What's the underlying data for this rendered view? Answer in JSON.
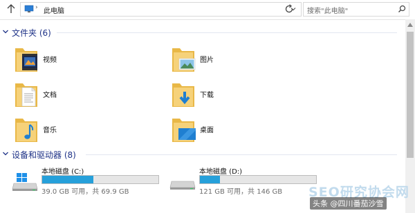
{
  "address_bar": {
    "path": "此电脑",
    "search_placeholder": "搜索\"此电脑\""
  },
  "groups": {
    "folders": {
      "title": "文件夹 (6)"
    },
    "devices": {
      "title": "设备和驱动器 (8)"
    }
  },
  "folders": [
    {
      "label": "视频",
      "icon": "videos-folder-icon"
    },
    {
      "label": "图片",
      "icon": "pictures-folder-icon"
    },
    {
      "label": "文档",
      "icon": "documents-folder-icon"
    },
    {
      "label": "下载",
      "icon": "downloads-folder-icon"
    },
    {
      "label": "音乐",
      "icon": "music-folder-icon"
    },
    {
      "label": "桌面",
      "icon": "desktop-folder-icon"
    }
  ],
  "drives": [
    {
      "name": "本地磁盘 (C:)",
      "size": "39.0 GB 可用，共 69.9 GB",
      "used_fraction": 0.44,
      "icon": "windows-drive-icon"
    },
    {
      "name": "本地磁盘 (D:)",
      "size": "121 GB 可用，共 146 GB",
      "used_fraction": 0.17,
      "icon": "drive-icon"
    }
  ],
  "watermark": {
    "site": "SEO研究协会网",
    "tag": "头条 @四川番茄沙雪"
  },
  "colors": {
    "group_title": "#1e3287",
    "drive_fill": "#26a0da",
    "folder_yellow": "#f4c560"
  }
}
